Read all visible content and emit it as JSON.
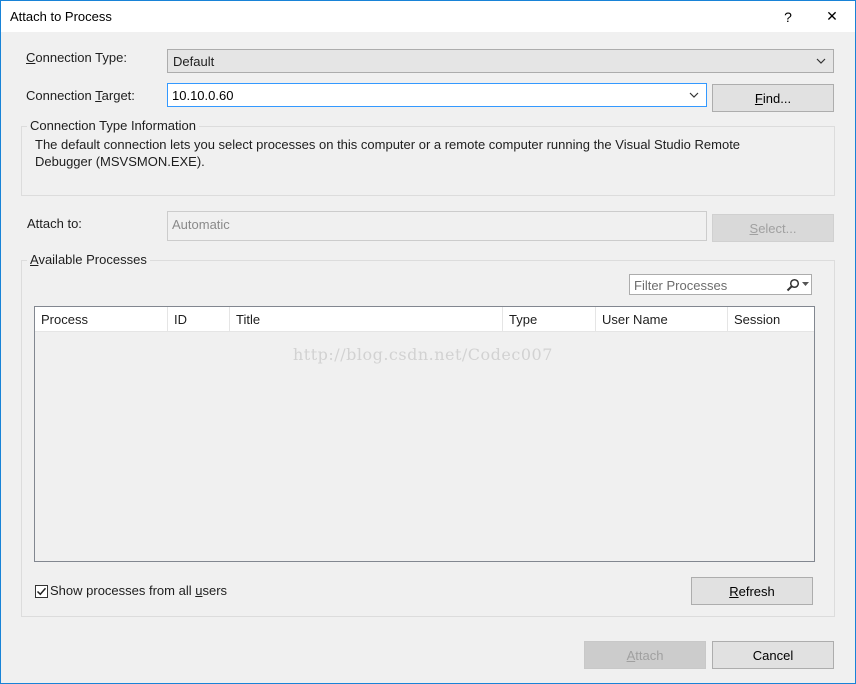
{
  "window": {
    "title": "Attach to Process",
    "help_glyph": "?",
    "close_glyph": "✕"
  },
  "connection_type": {
    "label_prefix": "",
    "label_access": "C",
    "label_rest": "onnection Type:",
    "value": "Default"
  },
  "connection_target": {
    "label_prefix": "Connection ",
    "label_access": "T",
    "label_rest": "arget:",
    "value": "10.10.0.60",
    "find_access": "F",
    "find_rest": "ind..."
  },
  "info_group": {
    "title": "Connection Type Information",
    "description_line1": "The default connection lets you select processes on this computer or a remote computer running the Visual Studio Remote",
    "description_line2": "Debugger (MSVSMON.EXE)."
  },
  "attach_to": {
    "label": "Attach to:",
    "value": "Automatic",
    "select_access": "S",
    "select_rest": "elect..."
  },
  "processes_group": {
    "title_prefix": "",
    "title_access": "A",
    "title_rest": "vailable Processes",
    "filter_placeholder": "Filter Processes",
    "columns": [
      "Process",
      "ID",
      "Title",
      "Type",
      "User Name",
      "Session"
    ],
    "rows": [],
    "watermark": "http://blog.csdn.net/Codec007",
    "show_all_users": {
      "checked": true,
      "label_prefix": "Show processes from all ",
      "label_access": "u",
      "label_rest": "sers"
    },
    "refresh_access": "R",
    "refresh_rest": "efresh"
  },
  "footer": {
    "attach_access": "A",
    "attach_rest": "ttach",
    "cancel_label": "Cancel"
  },
  "colors": {
    "window_border": "#1883d7",
    "focus_border": "#3399ff",
    "background": "#f0f0f0"
  },
  "icons": {
    "dropdown": "chevron-down-icon",
    "filter_search": "search-icon",
    "filter_dropdown": "caret-down-icon",
    "checkbox": "checkmark-icon"
  }
}
